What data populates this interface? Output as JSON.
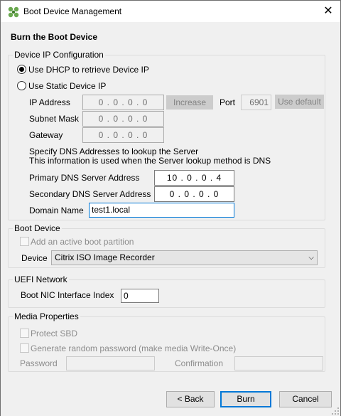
{
  "window": {
    "title": "Boot Device Management",
    "icon": "citrix-logo-icon",
    "close_glyph": "✕"
  },
  "heading": "Burn the Boot Device",
  "ip_config": {
    "legend": "Device IP Configuration",
    "dhcp_label": "Use DHCP to retrieve Device IP",
    "dhcp_selected": true,
    "static_label": "Use Static Device IP",
    "static_selected": false,
    "ip_label": "IP Address",
    "ip_value": "0 . 0 . 0 . 0",
    "increase_label": "Increase",
    "port_label": "Port",
    "port_value": "6901",
    "use_default_label": "Use default",
    "subnet_label": "Subnet Mask",
    "subnet_value": "0 . 0 . 0 . 0",
    "gateway_label": "Gateway",
    "gateway_value": "0 . 0 . 0 . 0",
    "dns_note_line1": "Specify DNS Addresses to lookup the Server",
    "dns_note_line2": "This information is used when the Server lookup method is DNS",
    "primary_dns_label": "Primary DNS Server Address",
    "primary_dns_value": "10 . 0 . 0 . 4",
    "secondary_dns_label": "Secondary DNS Server Address",
    "secondary_dns_value": "0 . 0 . 0 . 0",
    "domain_label": "Domain Name",
    "domain_value": "test1.local"
  },
  "boot_device": {
    "legend": "Boot Device",
    "add_partition_label": "Add an active boot partition",
    "device_label": "Device",
    "device_value": "Citrix ISO Image Recorder"
  },
  "uefi": {
    "legend": "UEFI Network",
    "nic_label": "Boot NIC Interface Index",
    "nic_value": "0"
  },
  "media": {
    "legend": "Media Properties",
    "protect_label": "Protect SBD",
    "random_pw_label": "Generate random password (make media Write-Once)",
    "password_label": "Password",
    "password_value": "",
    "confirmation_label": "Confirmation",
    "confirmation_value": ""
  },
  "footer": {
    "back_label": "< Back",
    "burn_label": "Burn",
    "cancel_label": "Cancel"
  },
  "colors": {
    "focus_border": "#0078d7",
    "dialog_bg": "#f0f0f0"
  }
}
